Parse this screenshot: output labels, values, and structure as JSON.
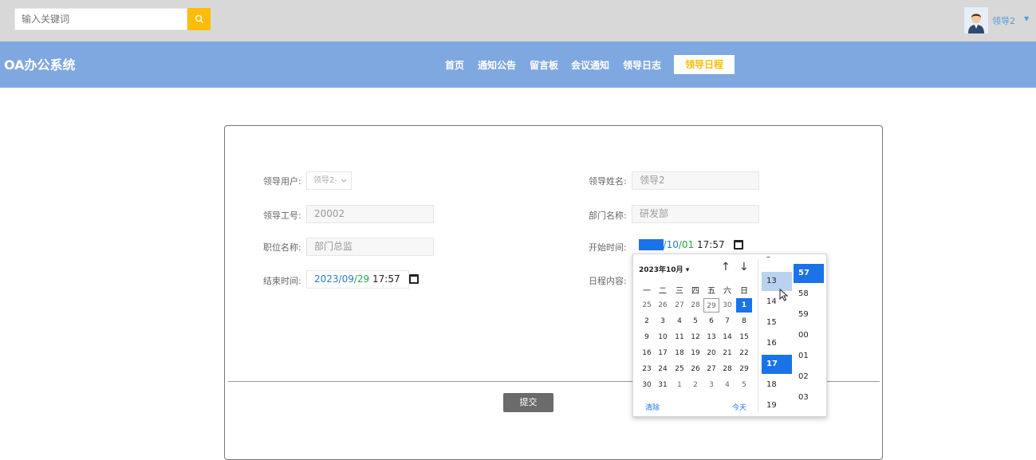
{
  "topbar": {
    "search_placeholder": "输入关键词",
    "user_name": "领导2",
    "user_caret": "▼",
    "accent_color": "#fbbd08"
  },
  "nav": {
    "brand": "OA办公系统",
    "items": [
      "首页",
      "通知公告",
      "留言板",
      "会议通知",
      "领导日志"
    ],
    "active": "领导日程"
  },
  "form": {
    "leader_user_label": "领导用户:",
    "leader_user_value": "领导2-",
    "leader_name_label": "领导姓名:",
    "leader_name_value": "领导2",
    "leader_no_label": "领导工号:",
    "leader_no_value": "20002",
    "dept_label": "部门名称:",
    "dept_value": "研发部",
    "position_label": "职位名称:",
    "position_value": "部门总监",
    "start_label": "开始时间:",
    "start_year": "2023",
    "start_month": "10",
    "start_day": "01",
    "start_time": "17:57",
    "end_label": "结束时间:",
    "end_year": "2023",
    "end_month": "09",
    "end_day": "29",
    "end_time": "17:57",
    "content_label": "日程内容:",
    "submit": "提交"
  },
  "picker": {
    "month_label": "2023年10月 ▾",
    "up": "↑",
    "down": "↓",
    "weekdays": [
      "一",
      "二",
      "三",
      "四",
      "五",
      "六",
      "日"
    ],
    "days": [
      [
        "25",
        "26",
        "27",
        "28",
        "29",
        "30",
        "1"
      ],
      [
        "2",
        "3",
        "4",
        "5",
        "6",
        "7",
        "8"
      ],
      [
        "9",
        "10",
        "11",
        "12",
        "13",
        "14",
        "15"
      ],
      [
        "16",
        "17",
        "18",
        "19",
        "20",
        "21",
        "22"
      ],
      [
        "23",
        "24",
        "25",
        "26",
        "27",
        "28",
        "29"
      ],
      [
        "30",
        "31",
        "1",
        "2",
        "3",
        "4",
        "5"
      ]
    ],
    "clear": "清除",
    "today": "今天",
    "hours": [
      "–",
      "13",
      "14",
      "15",
      "16",
      "17",
      "18",
      "19"
    ],
    "minutes": [
      "57",
      "58",
      "59",
      "00",
      "01",
      "02",
      "03"
    ],
    "selected_color": "#1a73e8"
  }
}
